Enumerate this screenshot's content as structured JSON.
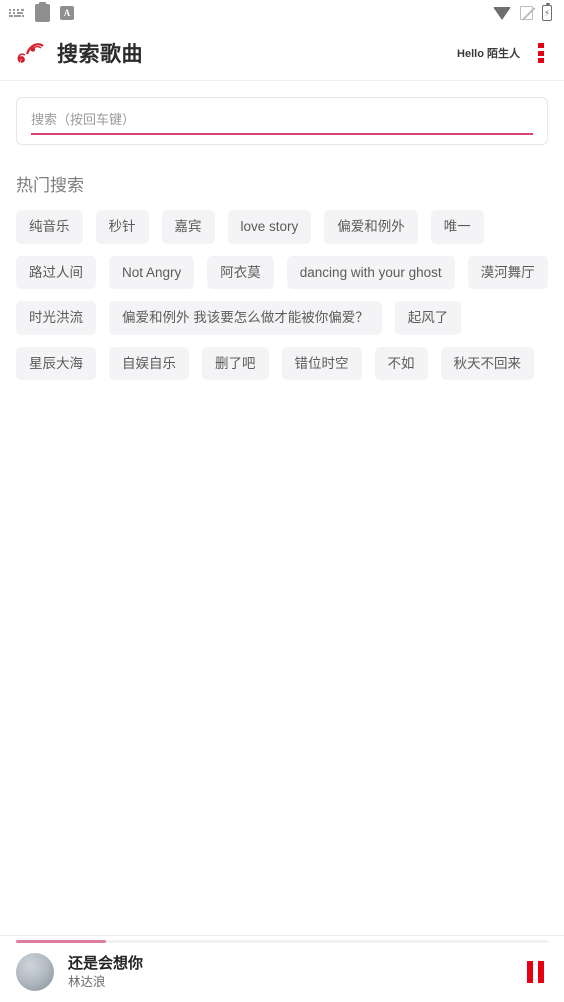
{
  "status_bar": {
    "left_icons": [
      {
        "name": "keyboard-icon",
        "label": "keyboard"
      },
      {
        "name": "clipboard-icon",
        "label": "clipboard"
      },
      {
        "name": "app-a-icon",
        "label": "A"
      }
    ],
    "right_icons": [
      {
        "name": "wifi-icon",
        "label": "wifi"
      },
      {
        "name": "cellular-signal-off-icon",
        "label": "no-signal"
      },
      {
        "name": "battery-charging-icon",
        "label": "battery charging"
      }
    ],
    "app_a_letter": "A",
    "battery_glyph": "⚡"
  },
  "header": {
    "logo_name": "music-note-logo",
    "title": "搜索歌曲",
    "greeting_prefix": "Hello",
    "username": "陌生人",
    "menu_name": "overflow-menu",
    "accent_color": "#e60012"
  },
  "search": {
    "placeholder": "搜索（按回车键）",
    "value": "",
    "underline_color": "#d8436f"
  },
  "hot_search": {
    "title": "热门搜索",
    "tags": [
      "纯音乐",
      "秒针",
      "嘉宾",
      "love story",
      "偏爱和例外",
      "唯一",
      "路过人间",
      "Not Angry",
      "阿衣莫",
      "dancing with your ghost",
      "漠河舞厅",
      "时光洪流",
      "偏爱和例外 我该要怎么做才能被你偏爱？",
      "起风了",
      "星辰大海",
      "自娱自乐",
      "删了吧",
      "错位时空",
      "不如",
      "秋天不回来"
    ]
  },
  "player": {
    "album_art_name": "album-art-placeholder",
    "track_title": "还是会想你",
    "artist": "林达浪",
    "progress_percent": 17,
    "control_state": "pause",
    "control_color": "#e60012",
    "progress_color": "#dd7e9b"
  }
}
